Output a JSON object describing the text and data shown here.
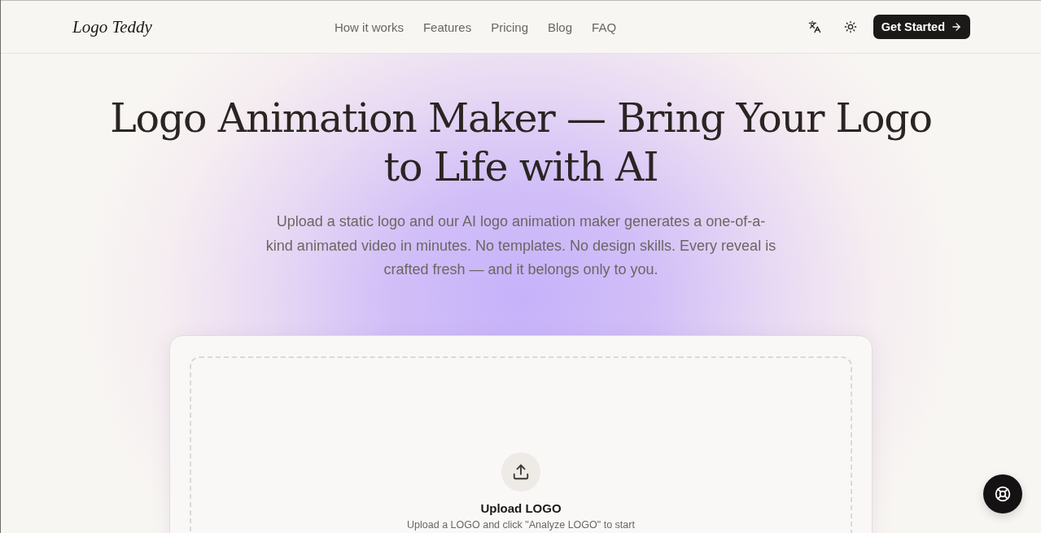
{
  "header": {
    "logo": "Logo Teddy",
    "nav": [
      "How it works",
      "Features",
      "Pricing",
      "Blog",
      "FAQ"
    ],
    "cta": "Get Started"
  },
  "hero": {
    "title": "Logo Animation Maker — Bring Your Logo to Life with AI",
    "subtitle": "Upload a static logo and our AI logo animation maker generates a one-of-a-kind animated video in minutes. No templates. No design skills. Every reveal is crafted fresh — and it belongs only to you."
  },
  "upload": {
    "title": "Upload LOGO",
    "hint": "Upload a LOGO and click \"Analyze LOGO\" to start"
  }
}
